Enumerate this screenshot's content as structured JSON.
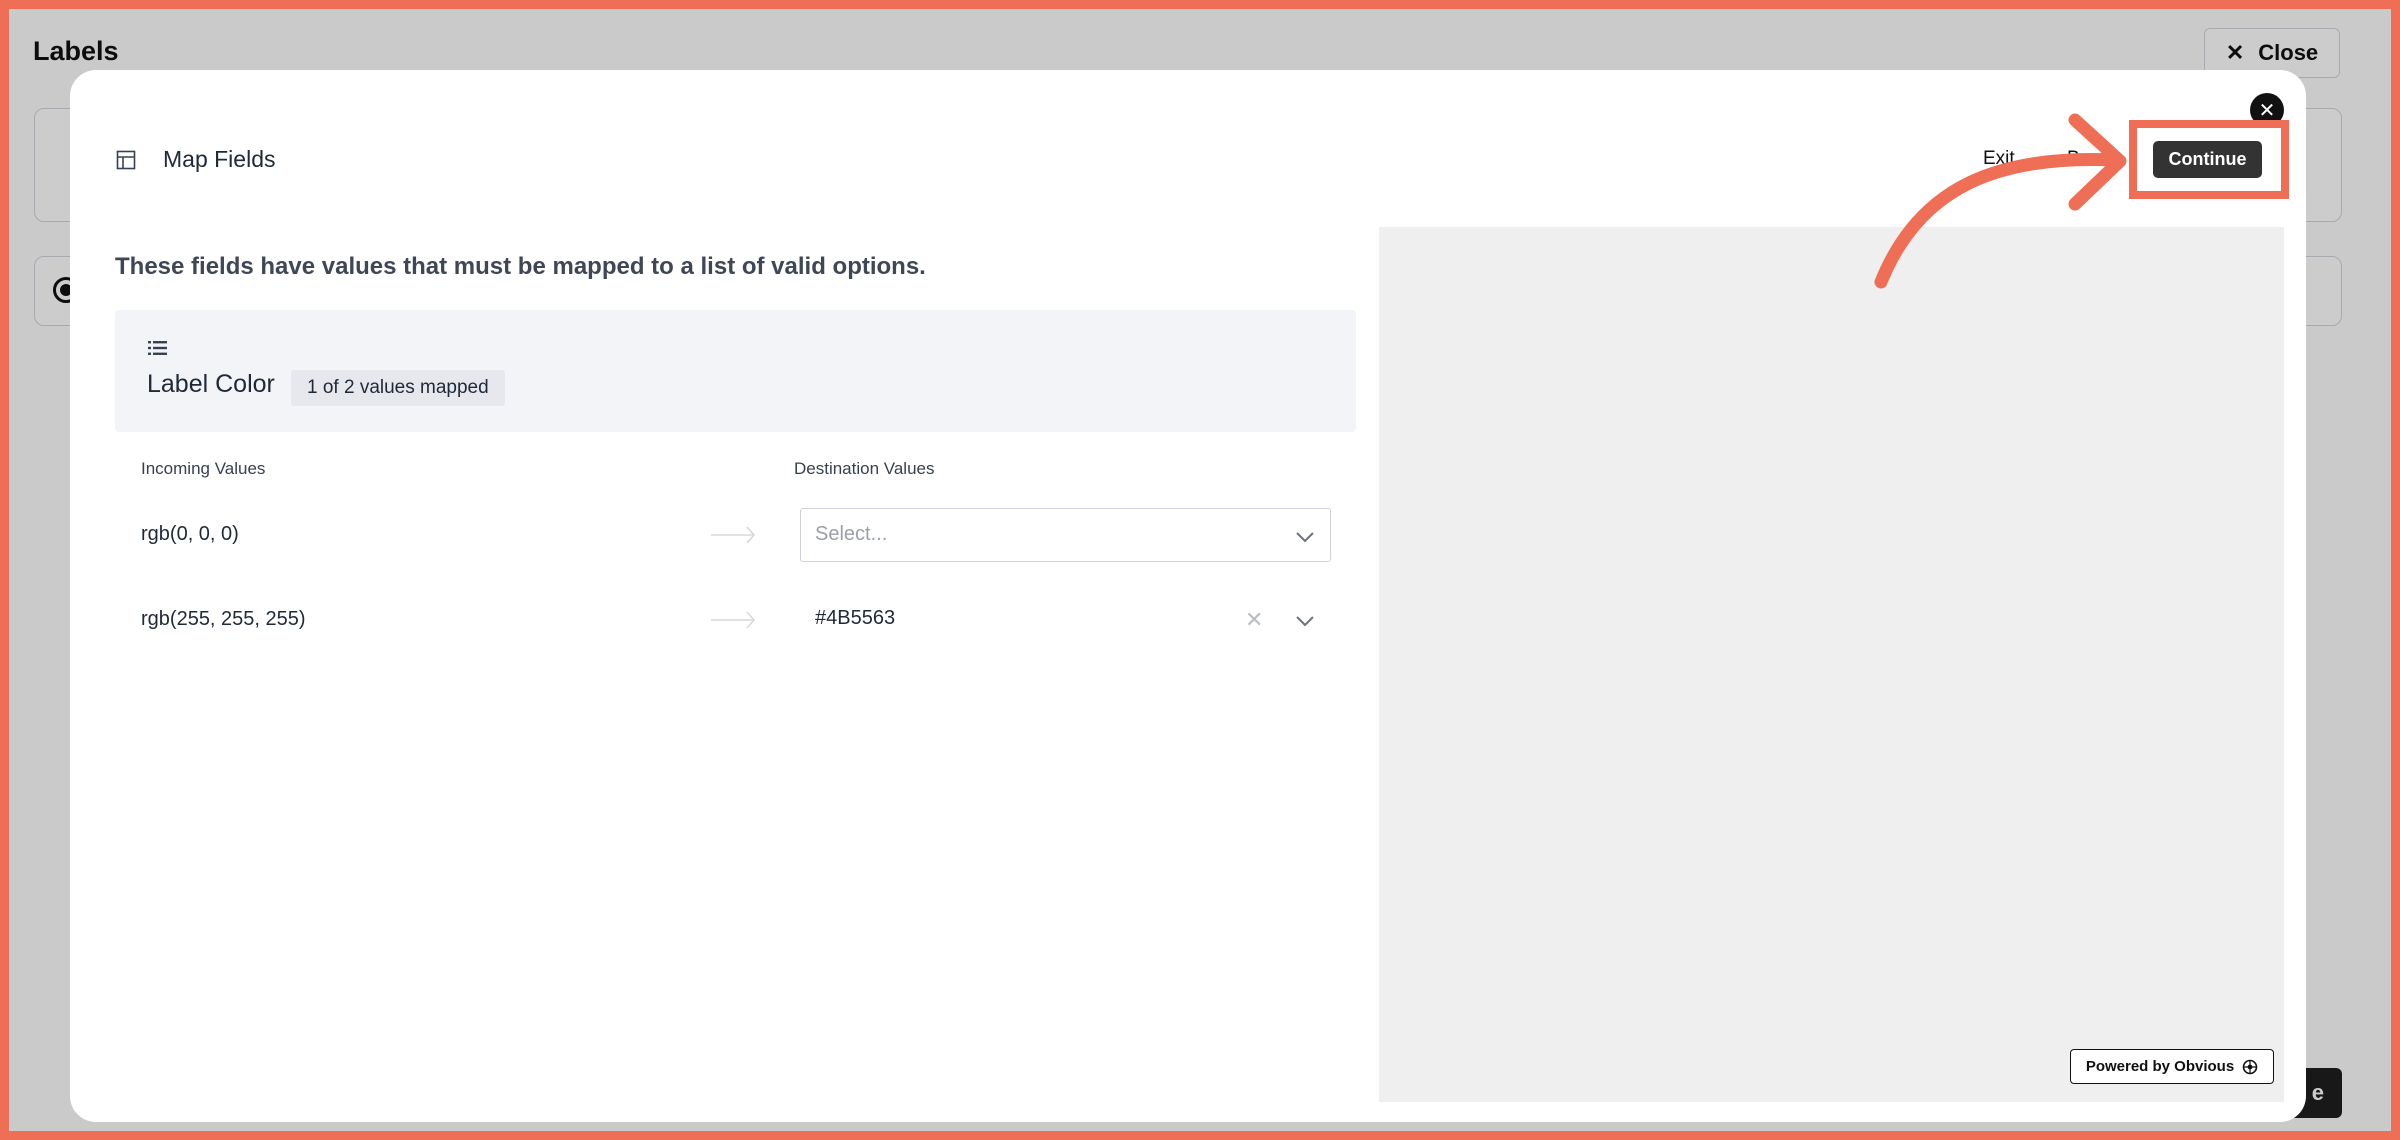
{
  "background_page": {
    "title": "Labels",
    "close_label": "Close",
    "save_label_partial": "e"
  },
  "modal": {
    "title": "Map Fields",
    "exit_label": "Exit",
    "back_label_partial": "B",
    "continue_label": "Continue",
    "heading": "These fields have values that must be mapped to a list of valid options.",
    "field": {
      "name": "Label Color",
      "badge": "1 of 2 values mapped"
    },
    "columns": {
      "incoming": "Incoming Values",
      "destination": "Destination Values"
    },
    "rows": [
      {
        "incoming": "rgb(0, 0, 0)",
        "destination": "",
        "placeholder": "Select..."
      },
      {
        "incoming": "rgb(255, 255, 255)",
        "destination": "#4B5563"
      }
    ],
    "powered_by": "Powered by Obvious"
  },
  "colors": {
    "annotation": "#ee6f55",
    "continue_button": "#333333",
    "preview_panel": "#efefef"
  },
  "icons": [
    "table-icon",
    "list-icon",
    "arrow-right-icon",
    "chevron-down-icon",
    "clear-icon",
    "close-icon",
    "obvious-logo-icon"
  ]
}
